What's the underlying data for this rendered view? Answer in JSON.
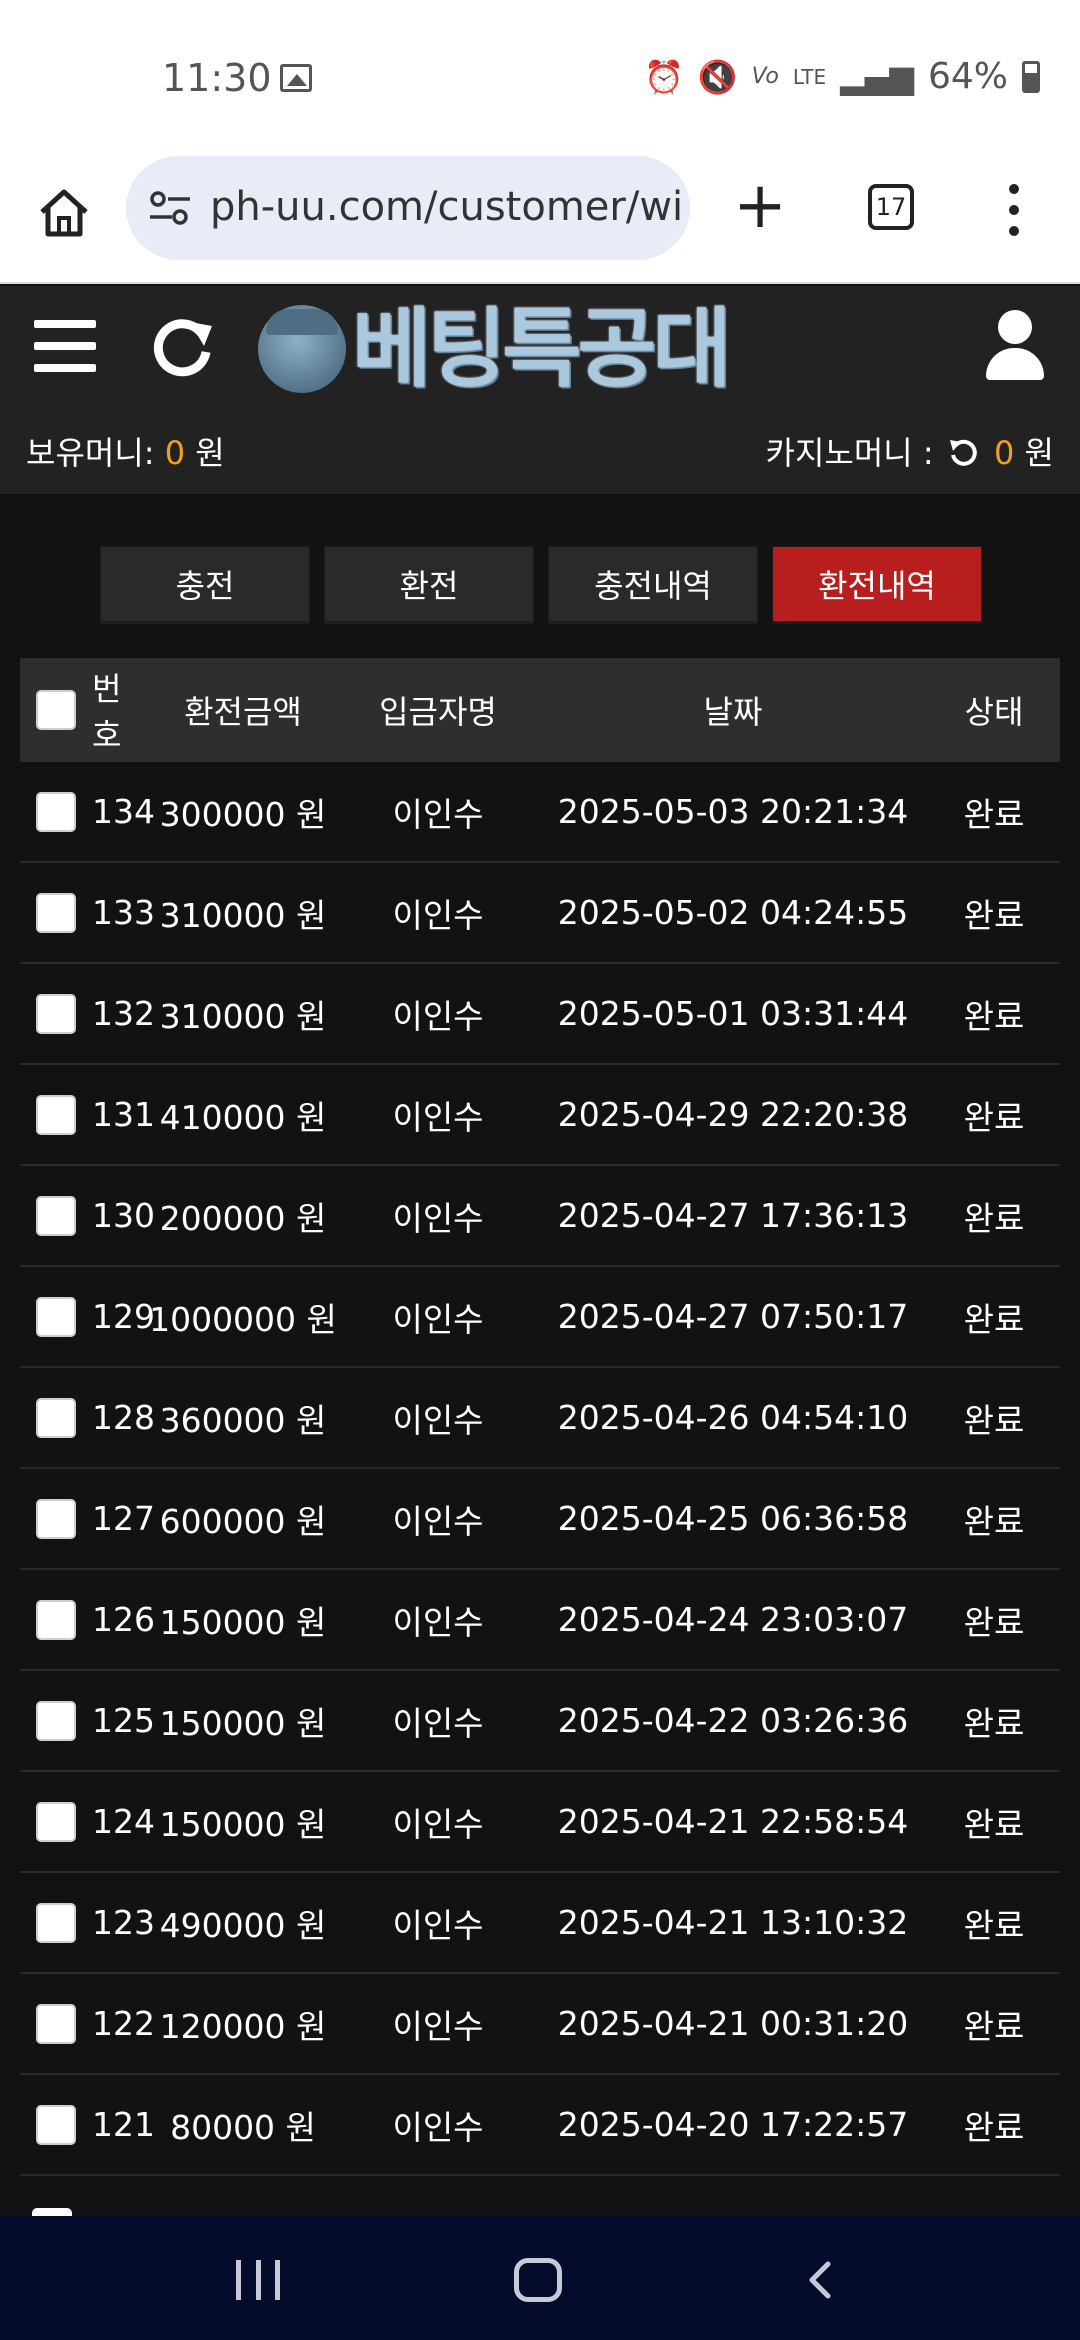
{
  "status_bar": {
    "time": "11:30",
    "lte_label": "LTE",
    "battery": "64%",
    "icons": [
      "gallery-icon",
      "alarm-icon",
      "mute-icon",
      "volte-icon",
      "lte-icon",
      "signal-icon",
      "battery-icon"
    ]
  },
  "browser": {
    "url": "ph-uu.com/customer/wit",
    "tab_count": "17",
    "new_tab_symbol": "+"
  },
  "site": {
    "logo_text": "베팅특공대",
    "balance_label": "보유머니:",
    "balance_value": "0",
    "balance_unit": "원",
    "casino_label": "카지노머니 :",
    "casino_value": "0",
    "casino_unit": "원"
  },
  "tabs": [
    {
      "label": "충전",
      "active": false
    },
    {
      "label": "환전",
      "active": false
    },
    {
      "label": "충전내역",
      "active": false
    },
    {
      "label": "환전내역",
      "active": true
    }
  ],
  "table": {
    "headers": {
      "num": "번호",
      "amount": "환전금액",
      "name": "입금자명",
      "date": "날짜",
      "status": "상태"
    },
    "rows": [
      {
        "num": "134",
        "amount": "300000 원",
        "name": "이인수",
        "date": "2025-05-03 20:21:34",
        "status": "완료"
      },
      {
        "num": "133",
        "amount": "310000 원",
        "name": "이인수",
        "date": "2025-05-02 04:24:55",
        "status": "완료"
      },
      {
        "num": "132",
        "amount": "310000 원",
        "name": "이인수",
        "date": "2025-05-01 03:31:44",
        "status": "완료"
      },
      {
        "num": "131",
        "amount": "410000 원",
        "name": "이인수",
        "date": "2025-04-29 22:20:38",
        "status": "완료"
      },
      {
        "num": "130",
        "amount": "200000 원",
        "name": "이인수",
        "date": "2025-04-27 17:36:13",
        "status": "완료"
      },
      {
        "num": "129",
        "amount": "1000000 원",
        "name": "이인수",
        "date": "2025-04-27 07:50:17",
        "status": "완료"
      },
      {
        "num": "128",
        "amount": "360000 원",
        "name": "이인수",
        "date": "2025-04-26 04:54:10",
        "status": "완료"
      },
      {
        "num": "127",
        "amount": "600000 원",
        "name": "이인수",
        "date": "2025-04-25 06:36:58",
        "status": "완료"
      },
      {
        "num": "126",
        "amount": "150000 원",
        "name": "이인수",
        "date": "2025-04-24 23:03:07",
        "status": "완료"
      },
      {
        "num": "125",
        "amount": "150000 원",
        "name": "이인수",
        "date": "2025-04-22 03:26:36",
        "status": "완료"
      },
      {
        "num": "124",
        "amount": "150000 원",
        "name": "이인수",
        "date": "2025-04-21 22:58:54",
        "status": "완료"
      },
      {
        "num": "123",
        "amount": "490000 원",
        "name": "이인수",
        "date": "2025-04-21 13:10:32",
        "status": "완료"
      },
      {
        "num": "122",
        "amount": "120000 원",
        "name": "이인수",
        "date": "2025-04-21 00:31:20",
        "status": "완료"
      },
      {
        "num": "121",
        "amount": "80000 원",
        "name": "이인수",
        "date": "2025-04-20 17:22:57",
        "status": "완료"
      }
    ]
  },
  "colors": {
    "accent_active_tab": "#b81e1e",
    "money_highlight": "#f0a020",
    "header_bg": "#222222",
    "nav_bar_bg": "#050b2b"
  }
}
